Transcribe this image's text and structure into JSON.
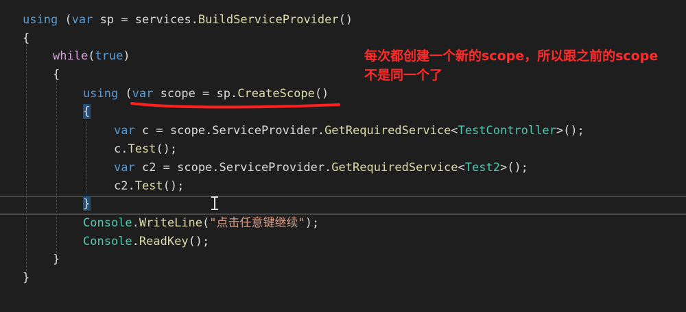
{
  "code": {
    "l1": {
      "kw_using": "using",
      "p1": " (",
      "kw_var": "var",
      "p2": " sp = services.",
      "method": "BuildServiceProvider",
      "p3": "()"
    },
    "l2": {
      "brace": "{"
    },
    "l3": {
      "kw_while": "while",
      "p1": "(",
      "kw_true": "true",
      "p2": ")"
    },
    "l4": {
      "brace": "{"
    },
    "l5": {
      "kw_using": "using",
      "p1": " (",
      "kw_var": "var",
      "p2": " scope = sp.",
      "method": "CreateScope",
      "p3": "()"
    },
    "l6": {
      "brace": "{"
    },
    "l7": {
      "kw_var": "var",
      "p1": " c = scope.ServiceProvider.",
      "method": "GetRequiredService",
      "p2": "<",
      "type": "TestController",
      "p3": ">();"
    },
    "l8": {
      "p1": "c.",
      "method": "Test",
      "p2": "();"
    },
    "l9": {
      "kw_var": "var",
      "p1": " c2 = scope.ServiceProvider.",
      "method": "GetRequiredService",
      "p2": "<",
      "type": "Test2",
      "p3": ">();"
    },
    "l10": {
      "p1": "c2.",
      "method": "Test",
      "p2": "();"
    },
    "l11": {
      "brace": "}"
    },
    "l12": {
      "type": "Console",
      "p1": ".",
      "method": "WriteLine",
      "p2": "(",
      "str": "\"点击任意键继续\"",
      "p3": ");"
    },
    "l13": {
      "type": "Console",
      "p1": ".",
      "method": "ReadKey",
      "p2": "();"
    },
    "l14": {
      "brace": "}"
    },
    "l15": {
      "brace": "}"
    }
  },
  "annotation": {
    "text": "每次都创建一个新的scope，所以跟之前的scope不是同一个了",
    "color": "#ff2b2b"
  },
  "colors": {
    "background": "#1e1e1e",
    "keyword": "#569cd6",
    "control": "#d8a0df",
    "type": "#4ec9b0",
    "method": "#dcdcaa",
    "string": "#d69d85"
  }
}
